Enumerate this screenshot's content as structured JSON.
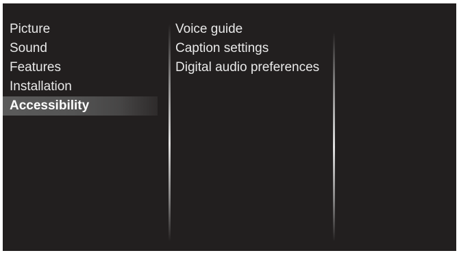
{
  "main_menu": {
    "items": [
      {
        "label": "Picture"
      },
      {
        "label": "Sound"
      },
      {
        "label": "Features"
      },
      {
        "label": "Installation"
      },
      {
        "label": "Accessibility",
        "selected": true
      }
    ]
  },
  "submenu": {
    "items": [
      {
        "label": "Voice guide"
      },
      {
        "label": "Caption settings"
      },
      {
        "label": "Digital audio preferences"
      }
    ]
  },
  "colors": {
    "background": "#221f1f",
    "text": "#e9e9e9",
    "highlight": "#5b5b5b"
  }
}
